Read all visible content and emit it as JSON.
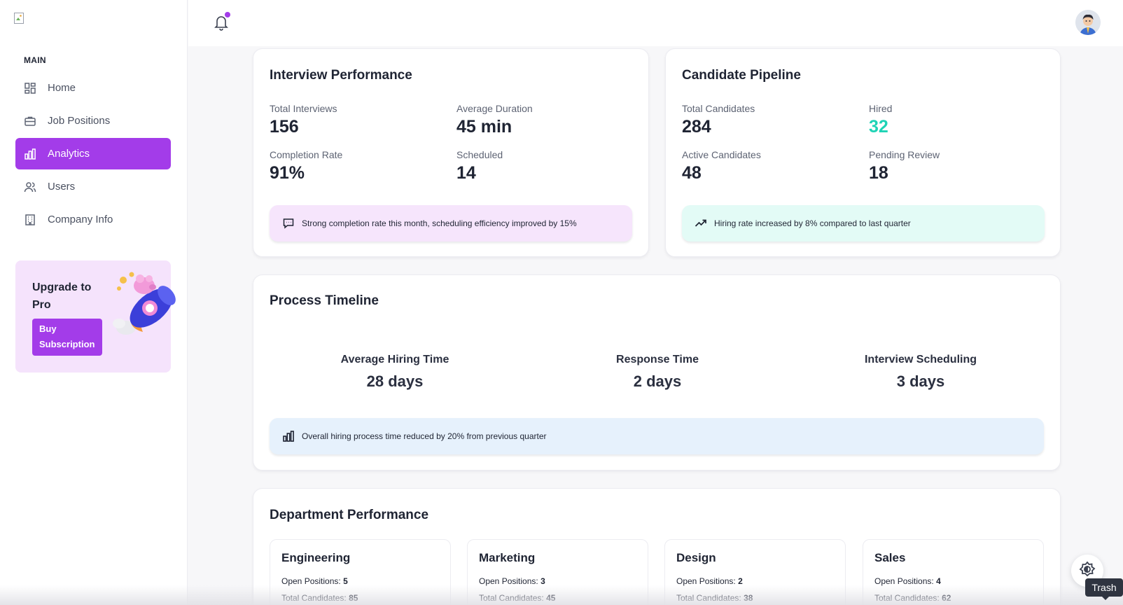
{
  "sidebar": {
    "section_label": "MAIN",
    "items": [
      {
        "label": "Home",
        "icon": "grid-icon",
        "active": false
      },
      {
        "label": "Job Positions",
        "icon": "briefcase-icon",
        "active": false
      },
      {
        "label": "Analytics",
        "icon": "bar-chart-icon",
        "active": true
      },
      {
        "label": "Users",
        "icon": "users-icon",
        "active": false
      },
      {
        "label": "Company Info",
        "icon": "building-icon",
        "active": false
      }
    ],
    "upgrade": {
      "title": "Upgrade to Pro",
      "button": "Buy Subscription"
    }
  },
  "colors": {
    "accent": "#a33ce9",
    "teal": "#1fd3b5",
    "note_purple": "#f6e5fc",
    "note_mint": "#e3fbf6",
    "note_blue": "#e6f1fc"
  },
  "interview_performance": {
    "title": "Interview Performance",
    "stats": [
      {
        "label": "Total Interviews",
        "value": "156"
      },
      {
        "label": "Average Duration",
        "value": "45 min"
      },
      {
        "label": "Completion Rate",
        "value": "91%"
      },
      {
        "label": "Scheduled",
        "value": "14"
      }
    ],
    "note": "Strong completion rate this month, scheduling efficiency improved by 15%"
  },
  "candidate_pipeline": {
    "title": "Candidate Pipeline",
    "stats": [
      {
        "label": "Total Candidates",
        "value": "284"
      },
      {
        "label": "Hired",
        "value": "32"
      },
      {
        "label": "Active Candidates",
        "value": "48"
      },
      {
        "label": "Pending Review",
        "value": "18"
      }
    ],
    "note": "Hiring rate increased by 8% compared to last quarter"
  },
  "process_timeline": {
    "title": "Process Timeline",
    "items": [
      {
        "label": "Average Hiring Time",
        "value": "28 days"
      },
      {
        "label": "Response Time",
        "value": "2 days"
      },
      {
        "label": "Interview Scheduling",
        "value": "3 days"
      }
    ],
    "note": "Overall hiring process time reduced by 20% from previous quarter"
  },
  "department_performance": {
    "title": "Department Performance",
    "open_label": "Open Positions:",
    "candidates_label": "Total Candidates:",
    "departments": [
      {
        "name": "Engineering",
        "open": "5",
        "candidates": "85"
      },
      {
        "name": "Marketing",
        "open": "3",
        "candidates": "45"
      },
      {
        "name": "Design",
        "open": "2",
        "candidates": "38"
      },
      {
        "name": "Sales",
        "open": "4",
        "candidates": "62"
      }
    ]
  },
  "tooltip": "Trash"
}
